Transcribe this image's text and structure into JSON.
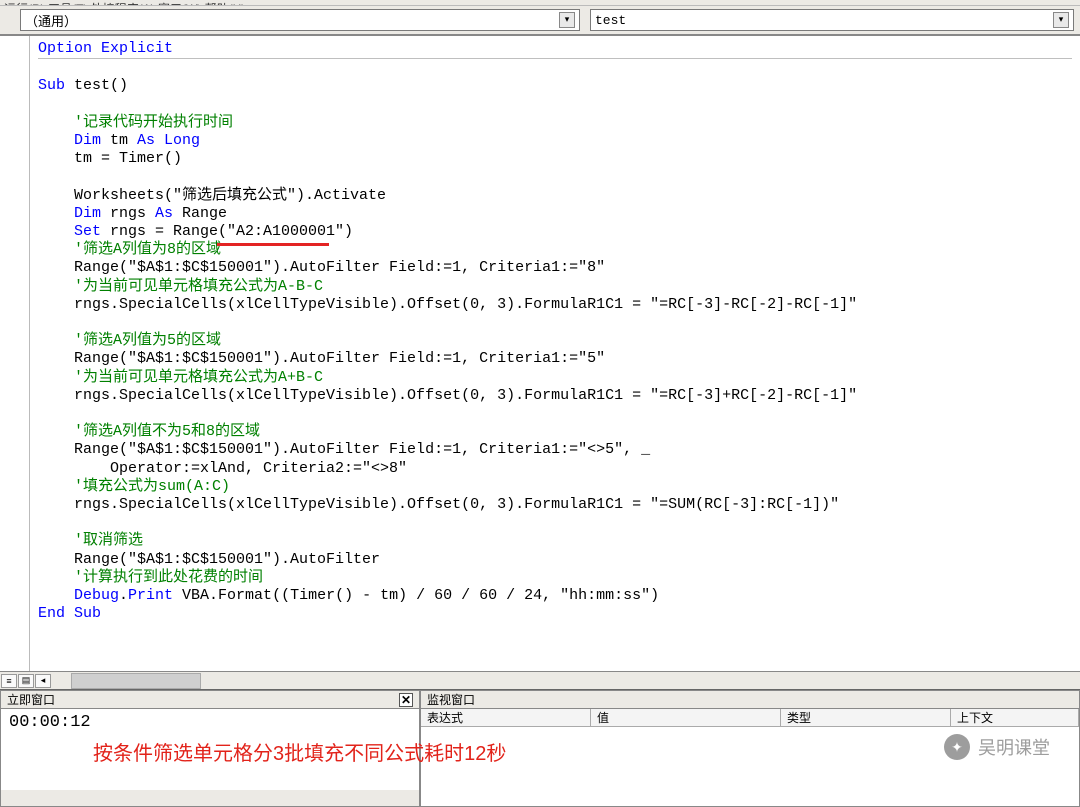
{
  "menubar_partial": "运行(R)  工具(T)  外接程序(A)  窗口(W)  帮助(H)",
  "dropdowns": {
    "left_value": "（通用）",
    "right_value": "test"
  },
  "code": {
    "lines": [
      {
        "t": "Option Explicit",
        "c": "kw"
      },
      {
        "t": "",
        "c": "text"
      },
      {
        "t": "Sub",
        "suffix": " test()",
        "c": "kw-leading"
      },
      {
        "t": "",
        "c": "text"
      },
      {
        "t": "    '记录代码开始执行时间",
        "c": "comment"
      },
      {
        "t": "    Dim",
        "mid": " tm ",
        "mid2": "As Long",
        "c": "kw-dim"
      },
      {
        "t": "    tm = Timer()",
        "c": "text"
      },
      {
        "t": "",
        "c": "text"
      },
      {
        "t": "    Worksheets(\"筛选后填充公式\").Activate",
        "c": "text"
      },
      {
        "t": "    Dim",
        "mid": " rngs ",
        "mid2": "As",
        "mid3": " Range",
        "c": "kw-dim2"
      },
      {
        "t": "    Set",
        "suffix": " rngs = Range(\"A2:A1000001\")",
        "c": "kw-leading"
      },
      {
        "t": "    '筛选A列值为8的区域",
        "c": "comment"
      },
      {
        "t": "    Range(\"$A$1:$C$150001\").AutoFilter Field:=1, Criteria1:=\"8\"",
        "c": "text"
      },
      {
        "t": "    '为当前可见单元格填充公式为A-B-C",
        "c": "comment"
      },
      {
        "t": "    rngs.SpecialCells(xlCellTypeVisible).Offset(0, 3).FormulaR1C1 = \"=RC[-3]-RC[-2]-RC[-1]\"",
        "c": "text"
      },
      {
        "t": "",
        "c": "text"
      },
      {
        "t": "    '筛选A列值为5的区域",
        "c": "comment"
      },
      {
        "t": "    Range(\"$A$1:$C$150001\").AutoFilter Field:=1, Criteria1:=\"5\"",
        "c": "text"
      },
      {
        "t": "    '为当前可见单元格填充公式为A+B-C",
        "c": "comment"
      },
      {
        "t": "    rngs.SpecialCells(xlCellTypeVisible).Offset(0, 3).FormulaR1C1 = \"=RC[-3]+RC[-2]-RC[-1]\"",
        "c": "text"
      },
      {
        "t": "",
        "c": "text"
      },
      {
        "t": "    '筛选A列值不为5和8的区域",
        "c": "comment"
      },
      {
        "t": "    Range(\"$A$1:$C$150001\").AutoFilter Field:=1, Criteria1:=\"<>5\", _",
        "c": "text"
      },
      {
        "t": "        Operator:=xlAnd, Criteria2:=\"<>8\"",
        "c": "text"
      },
      {
        "t": "    '填充公式为sum(A:C)",
        "c": "comment"
      },
      {
        "t": "    rngs.SpecialCells(xlCellTypeVisible).Offset(0, 3).FormulaR1C1 = \"=SUM(RC[-3]:RC[-1])\"",
        "c": "text"
      },
      {
        "t": "",
        "c": "text"
      },
      {
        "t": "    '取消筛选",
        "c": "comment"
      },
      {
        "t": "    Range(\"$A$1:$C$150001\").AutoFilter",
        "c": "text"
      },
      {
        "t": "    '计算执行到此处花费的时间",
        "c": "comment"
      },
      {
        "t": "    Debug",
        "mid": ".",
        "mid2": "Print",
        "suffix": " VBA.Format((Timer() - tm) / 60 / 60 / 24, \"hh:mm:ss\")",
        "c": "kw-debug"
      },
      {
        "t": "End Sub",
        "c": "kw"
      }
    ]
  },
  "immediate_window": {
    "title": "立即窗口",
    "output": "00:00:12",
    "annotation": "按条件筛选单元格分3批填充不同公式耗时12秒"
  },
  "watch_window": {
    "title": "监视窗口",
    "headers": {
      "h1": "表达式",
      "h2": "值",
      "h3": "类型",
      "h4": "上下文"
    }
  },
  "watermark": "吴明课堂"
}
